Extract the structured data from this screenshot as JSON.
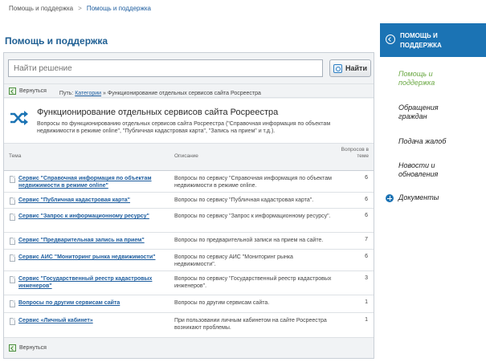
{
  "breadcrumb": {
    "home": "Помощь и поддержка",
    "separator": ">",
    "current": "Помощь и поддержка"
  },
  "page_title": "Помощь и поддержка",
  "search": {
    "placeholder": "Найти решение",
    "button_label": "Найти"
  },
  "toolbar": {
    "back_label": "Вернуться",
    "path_prefix": "Путь:",
    "path_link": "Категории",
    "path_arrow": "»",
    "path_current": "Функционирование отдельных сервисов сайта Росреестра"
  },
  "section": {
    "icon": "shuffle-icon",
    "title": "Функционирование отдельных сервисов сайта Росреестра",
    "description": "Вопросы по функционированию отдельных сервисов сайта Росреестра (\"Справочная информация по объектам недвижимости в режиме online\", \"Публичная кадастровая карта\", \"Запись на прием\" и т.д.)."
  },
  "table": {
    "headers": {
      "topic": "Тема",
      "description": "Описание",
      "count": "Вопросов в теме"
    },
    "rows": [
      {
        "topic": "Сервис \"Справочная информация по объектам недвижимости в режиме online\"",
        "description": "Вопросы по сервису \"Справочная информация по объектам недвижимости в режиме online.",
        "count": "6"
      },
      {
        "topic": "Сервис \"Публичная кадастровая карта\"",
        "description": "Вопросы по сервису \"Публичная кадастровая карта\".",
        "count": "6"
      },
      {
        "topic": "Сервис \"Запрос к информационному ресурсу\"",
        "description": "Вопросы по сервису \"Запрос к информационному ресурсу\".",
        "count": "6"
      },
      {
        "topic": "Сервис \"Предварительная запись на прием\"",
        "description": "Вопросы по предварительной записи на прием на сайте.",
        "count": "7"
      },
      {
        "topic": "Сервис АИС \"Мониторинг рынка недвижимости\"",
        "description": "Вопросы по сервису АИС \"Мониторинг рынка недвижимости\".",
        "count": "6"
      },
      {
        "topic": "Сервис \"Государственный реестр кадастровых инженеров\"",
        "description": "Вопросы по сервису \"Государственный реестр кадастровых инженеров\".",
        "count": "3"
      },
      {
        "topic": "Вопросы по другим сервисам сайта",
        "description": "Вопросы по другим сервисам сайта.",
        "count": "1"
      },
      {
        "topic": "Сервис «Личный кабинет»",
        "description": "При пользовании личным кабинетом на сайте Росреестра возникают проблемы.",
        "count": "1"
      }
    ]
  },
  "footer": {
    "back_label": "Вернуться"
  },
  "sidebar": {
    "header": "ПОМОЩЬ И ПОДДЕРЖКА",
    "items": [
      {
        "label": "Помощь и поддержка"
      },
      {
        "label": "Обращения граждан"
      },
      {
        "label": "Подача жалоб"
      },
      {
        "label": "Новости и обновления"
      },
      {
        "label": "Документы"
      }
    ]
  },
  "colors": {
    "accent": "#1b73b4",
    "link": "#1c5c9e",
    "active": "#6aa843"
  }
}
